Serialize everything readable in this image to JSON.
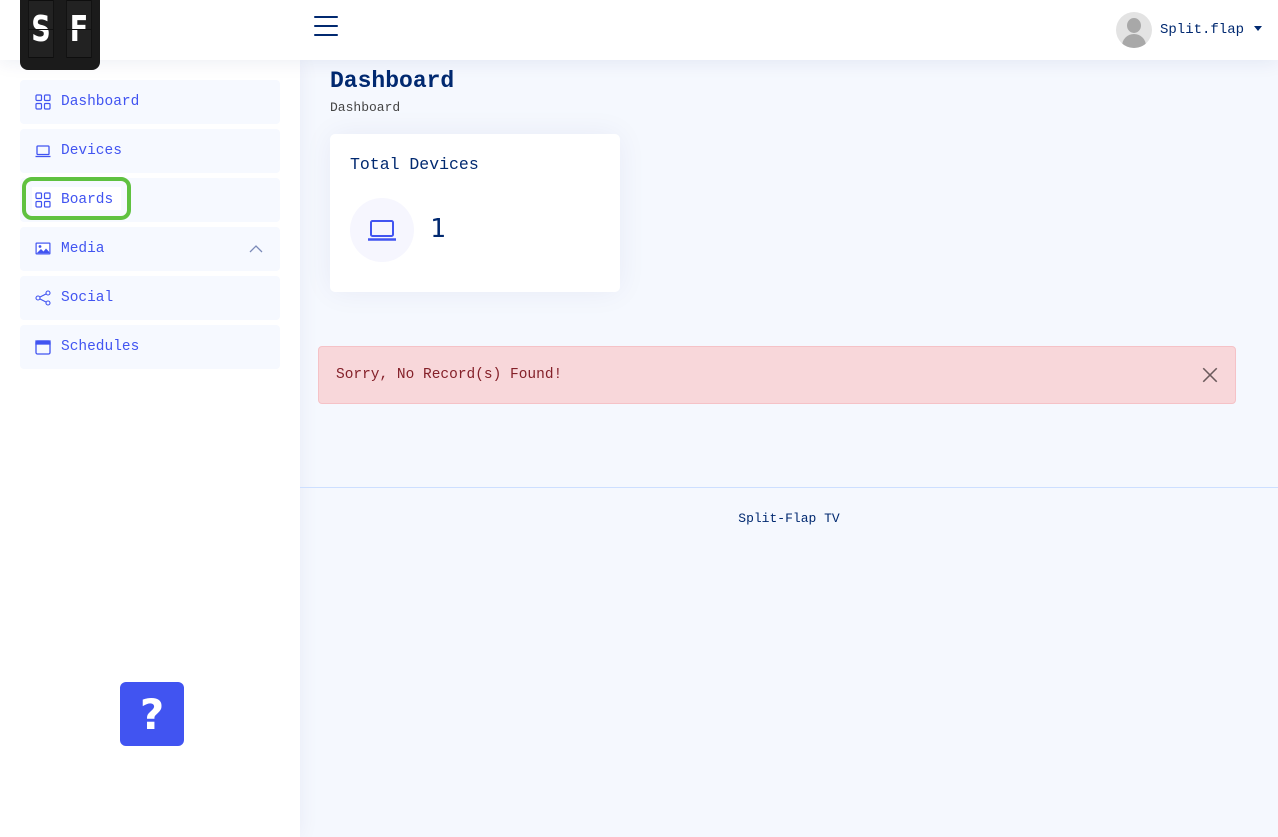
{
  "header": {
    "logo_letters": [
      "S",
      "F"
    ],
    "menu_icon": "hamburger-icon",
    "profile": {
      "name": "Split.flap",
      "avatar_icon": "user-avatar-icon",
      "dropdown_icon": "caret-down-icon"
    }
  },
  "sidebar": {
    "items": [
      {
        "label": "Dashboard",
        "icon": "grid-icon"
      },
      {
        "label": "Devices",
        "icon": "laptop-icon"
      },
      {
        "label": "Boards",
        "icon": "grid-icon"
      },
      {
        "label": "Media",
        "icon": "image-icon",
        "expand_icon": "chevron-up-icon"
      },
      {
        "label": "Social",
        "icon": "share-icon"
      },
      {
        "label": "Schedules",
        "icon": "calendar-icon"
      }
    ],
    "help_label": "?",
    "highlight_color": "#5fc140"
  },
  "main": {
    "title": "Dashboard",
    "breadcrumb": "Dashboard",
    "card": {
      "title": "Total Devices",
      "icon": "laptop-icon",
      "value": "1"
    },
    "alert": {
      "message": "Sorry, No Record(s) Found!",
      "close_icon": "close-icon"
    },
    "footer": "Split-Flap TV"
  },
  "colors": {
    "accent": "#4154f1",
    "navy": "#012970",
    "alert_bg": "#f8d7da",
    "alert_text": "#842029"
  }
}
